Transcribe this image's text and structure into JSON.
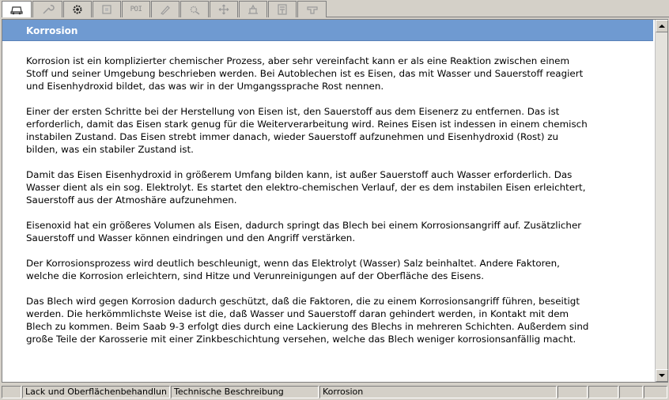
{
  "toolbar": {
    "tabs": [
      {
        "name": "tab-car-overview",
        "icon": "car-icon"
      },
      {
        "name": "tab-tools",
        "icon": "wrench-icon"
      },
      {
        "name": "tab-components",
        "icon": "gear-icon"
      },
      {
        "name": "tab-diagnostics",
        "icon": "module-icon"
      },
      {
        "name": "tab-poi",
        "icon": "poi-text",
        "label": "POI"
      },
      {
        "name": "tab-repair",
        "icon": "screwdriver-icon"
      },
      {
        "name": "tab-settings",
        "icon": "cog-icon"
      },
      {
        "name": "tab-navigation",
        "icon": "move-icon"
      },
      {
        "name": "tab-lift",
        "icon": "lift-icon"
      },
      {
        "name": "tab-documents",
        "icon": "document-icon"
      },
      {
        "name": "tab-accessories",
        "icon": "seat-icon"
      }
    ]
  },
  "header": {
    "title": "Korrosion"
  },
  "content": {
    "paragraphs": [
      "Korrosion ist ein komplizierter chemischer Prozess, aber sehr vereinfacht kann er als eine Reaktion zwischen einem\nStoff und seiner Umgebung beschrieben werden. Bei Autoblechen ist es Eisen, das mit Wasser und Sauerstoff reagiert\nund Eisenhydroxid bildet, das was wir in der Umgangssprache Rost nennen.",
      "Einer der ersten Schritte bei der Herstellung von Eisen ist, den Sauerstoff aus dem Eisenerz zu entfernen. Das ist\nerforderlich, damit das Eisen stark genug für die Weiterverarbeitung wird. Reines Eisen ist indessen in einem chemisch\ninstabilen Zustand. Das Eisen strebt immer danach, wieder Sauerstoff aufzunehmen und Eisenhydroxid (Rost) zu\nbilden, was ein stabiler Zustand ist.",
      "Damit das Eisen Eisenhydroxid in größerem Umfang bilden kann, ist außer Sauerstoff auch Wasser erforderlich. Das\nWasser dient als ein sog. Elektrolyt. Es startet den elektro-chemischen Verlauf, der es dem instabilen Eisen erleichtert,\nSauerstoff aus der Atmoshäre aufzunehmen.",
      "Eisenoxid hat ein größeres Volumen als Eisen, dadurch springt das Blech bei einem Korrosionsangriff auf. Zusätzlicher\nSauerstoff und Wasser können eindringen und den Angriff verstärken.",
      "Der Korrosionsprozess wird deutlich beschleunigt, wenn das Elektrolyt (Wasser) Salz beinhaltet. Andere Faktoren,\nwelche die Korrosion erleichtern, sind Hitze und Verunreinigungen auf der Oberfläche des Eisens.",
      "Das Blech wird gegen Korrosion dadurch geschützt, daß die Faktoren, die zu einem Korrosionsangriff führen, beseitigt\nwerden. Die herkömmlichste Weise ist die, daß Wasser und Sauerstoff daran gehindert werden, in Kontakt mit dem\nBlech zu kommen. Beim Saab 9-3 erfolgt dies durch eine Lackierung des Blechs in mehreren Schichten. Außerdem sind\ngroße Teile der Karosserie mit einer Zinkbeschichtung versehen, welche das Blech weniger korrosionsanfällig macht."
    ]
  },
  "statusbar": {
    "section": "Lack und Oberflächenbehandlun",
    "category": "Technische Beschreibung",
    "topic": "Korrosion"
  }
}
